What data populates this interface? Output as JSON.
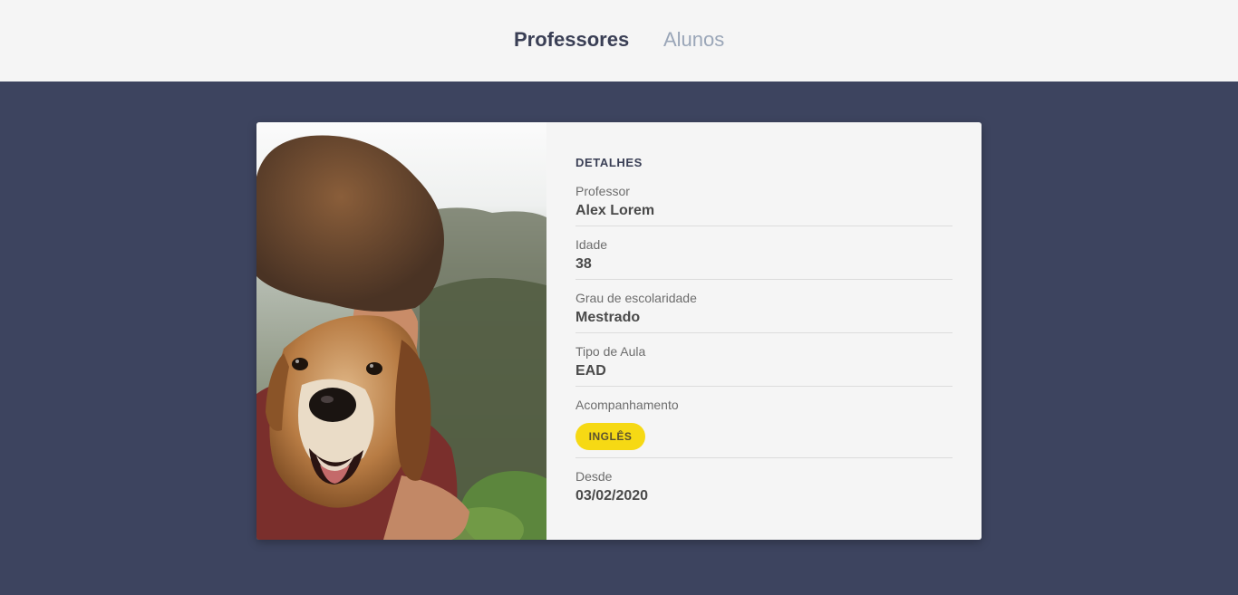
{
  "nav": {
    "professores": "Professores",
    "alunos": "Alunos"
  },
  "card": {
    "image_alt": "man-hugging-dog-photo",
    "section_title": "DETALHES",
    "fields": [
      {
        "label": "Professor",
        "value": "Alex Lorem"
      },
      {
        "label": "Idade",
        "value": "38"
      },
      {
        "label": "Grau de escolaridade",
        "value": "Mestrado"
      },
      {
        "label": "Tipo de Aula",
        "value": "EAD"
      },
      {
        "label": "Acompanhamento",
        "badge": "INGLÊS"
      },
      {
        "label": "Desde",
        "value": "03/02/2020"
      }
    ]
  },
  "colors": {
    "background": "#3d445f",
    "header": "#f5f5f5",
    "card": "#f5f5f5",
    "badge": "#f6d914",
    "nav_active": "#3a3f55",
    "nav_inactive": "#9aa6b8"
  }
}
